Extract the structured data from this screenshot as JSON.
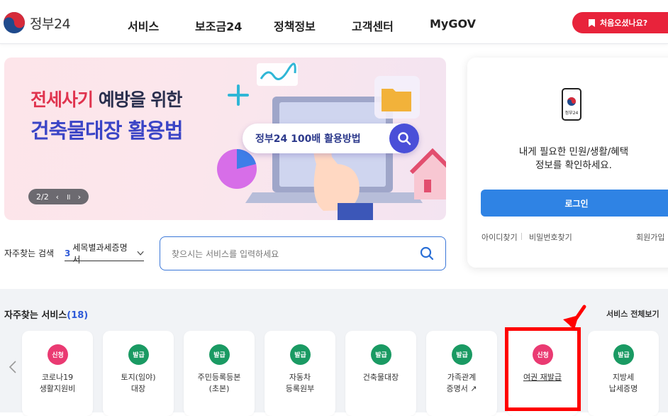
{
  "header": {
    "logo_text": "정부24",
    "nav": [
      "서비스",
      "보조금24",
      "정책정보",
      "고객센터",
      "MyGOV"
    ],
    "first_visit_label": "처음오셨나요?"
  },
  "banner": {
    "line1_highlight": "전세사기",
    "line1_rest": " 예방을 위한",
    "line2": "건축물대장 활용법",
    "search_pill": "정부24 100배 활용방법",
    "counter": "2/2",
    "pause_symbol": "॥",
    "prev_symbol": "‹",
    "next_symbol": "›"
  },
  "login_card": {
    "phone_label": "정부24",
    "message_line1": "내게 필요한 민원/생활/혜택",
    "message_line2": "정보를 확인하세요.",
    "login_label": "로그인",
    "find_id": "아이디찾기",
    "find_pw": "비밀번호찾기",
    "signup": "회원가입"
  },
  "search": {
    "freq_label": "자주찾는 검색",
    "freq_rank": "3",
    "freq_value": "세목별과세증명서",
    "placeholder": "찾으시는 서비스를 입력하세요"
  },
  "services": {
    "title": "자주찾는 서비스",
    "count": "(18)",
    "view_all": "서비스 전체보기",
    "items": [
      {
        "badge": "신청",
        "label": "코로나19\n생활지원비"
      },
      {
        "badge": "발급",
        "label": "토지(임야)\n대장"
      },
      {
        "badge": "발급",
        "label": "주민등록등본\n(초본)"
      },
      {
        "badge": "발급",
        "label": "자동차\n등록원부"
      },
      {
        "badge": "발급",
        "label": "건축물대장"
      },
      {
        "badge": "발급",
        "label": "가족관계\n증명서 ↗"
      },
      {
        "badge": "신청",
        "label": "여권 재발급"
      },
      {
        "badge": "발급",
        "label": "지방세\n납세증명"
      }
    ]
  },
  "colors": {
    "accent_blue": "#2f83e4",
    "badge_red": "#ea3a72",
    "badge_green": "#1a9a63",
    "highlight_red": "#ff0000"
  }
}
